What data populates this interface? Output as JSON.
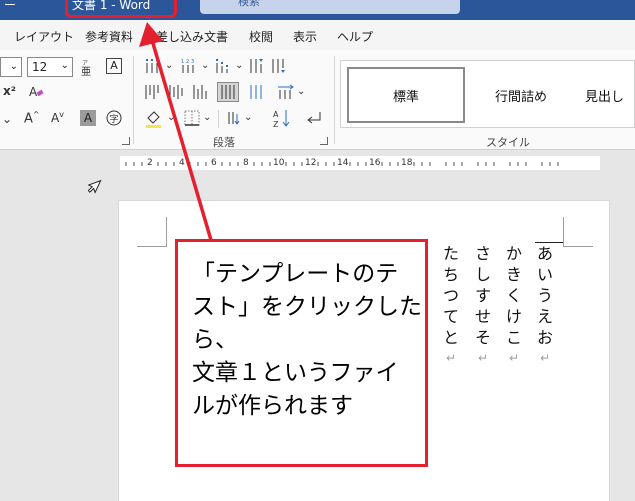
{
  "titlebar": {
    "left_glyph": "ー",
    "title_fragment": "文書 1 - Word",
    "search_placeholder": "検索"
  },
  "menu": {
    "tabs": [
      "レイアウト",
      "参考資料",
      "差し込み文書",
      "校閲",
      "表示",
      "ヘルプ"
    ]
  },
  "ribbon": {
    "font_size": "12",
    "char_shading_label": "A",
    "groups": {
      "paragraph": "段落",
      "styles": "スタイル"
    },
    "styles": [
      "標準",
      "行間詰め",
      "見出し"
    ]
  },
  "ruler": {
    "numbers": [
      "2",
      "4",
      "6",
      "8",
      "10",
      "12",
      "14",
      "16",
      "18"
    ]
  },
  "document": {
    "columns": [
      {
        "chars": [
          "あ",
          "い",
          "う",
          "え",
          "お"
        ],
        "mark": "↵"
      },
      {
        "chars": [
          "か",
          "き",
          "く",
          "け",
          "こ"
        ],
        "mark": "↵"
      },
      {
        "chars": [
          "さ",
          "し",
          "す",
          "せ",
          "そ"
        ],
        "mark": "↵"
      },
      {
        "chars": [
          "た",
          "ち",
          "つ",
          "て",
          "と"
        ],
        "mark": "↵"
      }
    ]
  },
  "annotation": {
    "lines": [
      "「テンプレートのテ",
      "スト」をクリックした",
      "ら、",
      "文章１というファイ",
      "ルが作られます"
    ]
  },
  "colors": {
    "accent_red": "#e5202e",
    "word_blue": "#2b579a"
  }
}
